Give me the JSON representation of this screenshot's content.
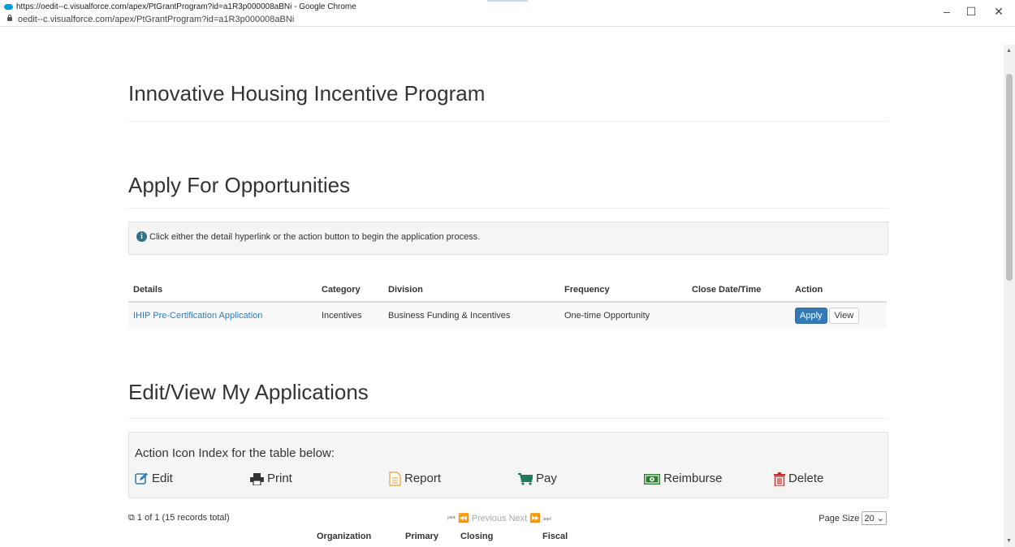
{
  "browser": {
    "window_title": "https://oedit--c.visualforce.com/apex/PtGrantProgram?id=a1R3p000008aBNi - Google Chrome",
    "url": "oedit--c.visualforce.com/apex/PtGrantProgram?id=a1R3p000008aBNi",
    "minimize": "–",
    "maximize": "☐",
    "close": "✕"
  },
  "page": {
    "title": "Innovative Housing Incentive Program",
    "apply_heading": "Apply For Opportunities",
    "info_text": "Click either the detail hyperlink or the action button to begin the application process.",
    "opportunities": {
      "headers": [
        "Details",
        "Category",
        "Division",
        "Frequency",
        "Close Date/Time",
        "Action"
      ],
      "rows": [
        {
          "details": "IHIP Pre-Certification Application",
          "category": "Incentives",
          "division": "Business Funding & Incentives",
          "frequency": "One-time Opportunity",
          "close_date": "",
          "apply_label": "Apply",
          "view_label": "View"
        }
      ]
    },
    "my_apps_heading": "Edit/View My Applications",
    "icon_index": {
      "title": "Action Icon Index for the table below:",
      "edit": "Edit",
      "print": "Print",
      "report": "Report",
      "pay": "Pay",
      "reimburse": "Reimburse",
      "delete": "Delete"
    },
    "pager": {
      "summary": "1 of 1 (15 records total)",
      "previous": "Previous",
      "next": "Next",
      "page_size_label": "Page Size",
      "page_size_value": "20"
    },
    "partial_headers": [
      "Organization",
      "Primary",
      "Closing",
      "Fiscal"
    ]
  },
  "colors": {
    "link": "#337ab7",
    "apply_button": "#337ab7",
    "edit_icon": "#337ab7",
    "report_icon": "#f0ad4e",
    "pay_icon": "#1e7b5c",
    "reimburse_icon": "#2e7d32",
    "delete_icon": "#c9302c"
  }
}
